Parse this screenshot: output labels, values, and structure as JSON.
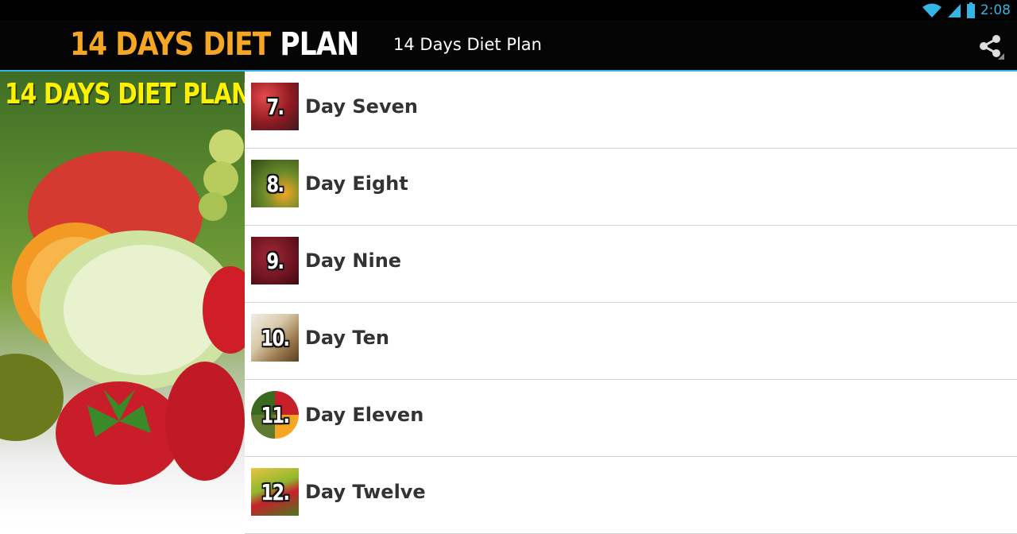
{
  "status_bar": {
    "time": "2:08"
  },
  "action_bar": {
    "logo": {
      "part1": "14 DAYS",
      "part2": "DIET",
      "part3": "PLAN"
    },
    "title": "14 Days Diet Plan",
    "share_icon": "share-icon"
  },
  "banner": {
    "title": "14 DAYS DIET PLAN"
  },
  "list": {
    "items": [
      {
        "number": "7.",
        "label": "Day Seven",
        "thumb_color": "#b2202b"
      },
      {
        "number": "8.",
        "label": "Day Eight",
        "thumb_color": "#6a8a2a"
      },
      {
        "number": "9.",
        "label": "Day Nine",
        "thumb_color": "#7a1620"
      },
      {
        "number": "10.",
        "label": "Day Ten",
        "thumb_color": "#9c7a4e"
      },
      {
        "number": "11.",
        "label": "Day Eleven",
        "thumb_color": "#5f7a2e"
      },
      {
        "number": "12.",
        "label": "Day Twelve",
        "thumb_color": "#7aa02c"
      }
    ]
  },
  "colors": {
    "accent": "#33b5e5",
    "logo_orange": "#f5a623",
    "banner_yellow": "#fff200"
  }
}
